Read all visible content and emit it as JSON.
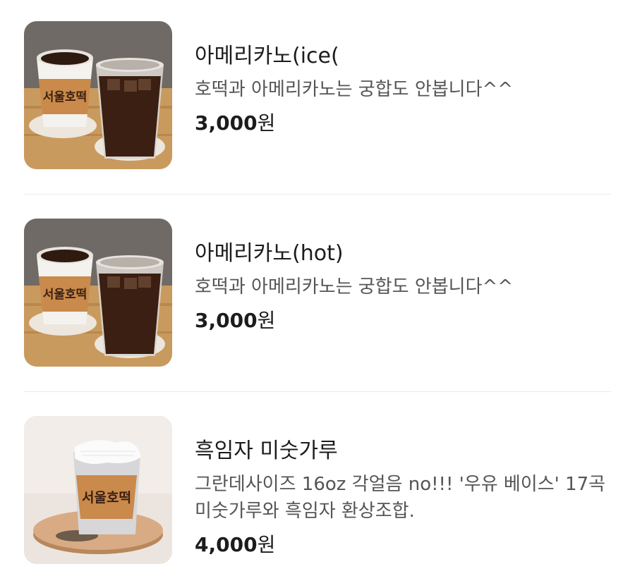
{
  "menu": {
    "items": [
      {
        "name": "아메리카노(ice(",
        "description": "호떡과 아메리카노는 궁합도 안봅니다^^",
        "price": "3,000",
        "currency": "원",
        "cup_logo": "서울호떡"
      },
      {
        "name": "아메리카노(hot)",
        "description": "호떡과 아메리카노는 궁합도 안봅니다^^",
        "price": "3,000",
        "currency": "원",
        "cup_logo": "서울호떡"
      },
      {
        "name": "흑임자 미숫가루",
        "description": "그란데사이즈 16oz 각얼음 no!!! '우유 베이스' 17곡 미숫가루와 흑임자 환상조합.",
        "price": "4,000",
        "currency": "원",
        "cup_logo": "서울호떡"
      }
    ]
  },
  "colors": {
    "text_primary": "#1c1c1c",
    "text_secondary": "#555555",
    "divider": "#ececec",
    "cup_sleeve": "#c98a4b",
    "coffee": "#3a1f12"
  }
}
